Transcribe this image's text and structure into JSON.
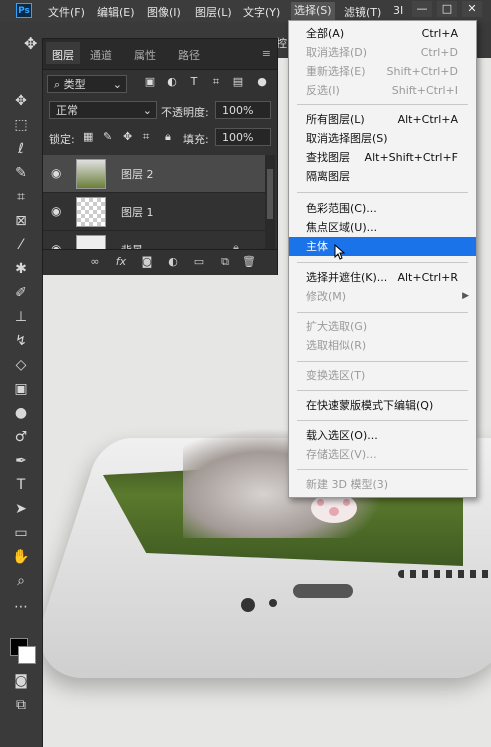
{
  "app": {
    "logo_text": "Ps"
  },
  "menubar": {
    "items": [
      {
        "label": "文件(F)"
      },
      {
        "label": "编辑(E)"
      },
      {
        "label": "图像(I)"
      },
      {
        "label": "图层(L)"
      },
      {
        "label": "文字(Y)"
      },
      {
        "label": "选择(S)"
      },
      {
        "label": "滤镜(T)"
      },
      {
        "label": "3I"
      }
    ],
    "window_buttons": [
      "—",
      "□",
      "✕"
    ]
  },
  "options_bar": {
    "move_icon": "move-icon",
    "label_partial": "控"
  },
  "layers_panel": {
    "tabs": [
      {
        "label": "图层"
      },
      {
        "label": "通道"
      },
      {
        "label": "属性"
      },
      {
        "label": "路径"
      }
    ],
    "filter_kind": "类型",
    "blend_mode": "正常",
    "opacity_label": "不透明度:",
    "opacity_value": "100%",
    "lock_label": "锁定:",
    "fill_label": "填充:",
    "fill_value": "100%",
    "layers": [
      {
        "name": "图层 2"
      },
      {
        "name": "图层 1"
      },
      {
        "name": "背景"
      }
    ]
  },
  "select_menu": {
    "items": [
      {
        "label": "全部(A)",
        "shortcut": "Ctrl+A",
        "enabled": true
      },
      {
        "label": "取消选择(D)",
        "shortcut": "Ctrl+D",
        "enabled": false
      },
      {
        "label": "重新选择(E)",
        "shortcut": "Shift+Ctrl+D",
        "enabled": false
      },
      {
        "label": "反选(I)",
        "shortcut": "Shift+Ctrl+I",
        "enabled": false
      },
      {
        "label": "所有图层(L)",
        "shortcut": "Alt+Ctrl+A",
        "enabled": true
      },
      {
        "label": "取消选择图层(S)",
        "shortcut": "",
        "enabled": true
      },
      {
        "label": "查找图层",
        "shortcut": "Alt+Shift+Ctrl+F",
        "enabled": true
      },
      {
        "label": "隔离图层",
        "shortcut": "",
        "enabled": true
      },
      {
        "label": "色彩范围(C)...",
        "shortcut": "",
        "enabled": true
      },
      {
        "label": "焦点区域(U)...",
        "shortcut": "",
        "enabled": true
      },
      {
        "label": "主体",
        "shortcut": "",
        "enabled": true,
        "highlighted": true
      },
      {
        "label": "选择并遮住(K)...",
        "shortcut": "Alt+Ctrl+R",
        "enabled": true
      },
      {
        "label": "修改(M)",
        "shortcut": "",
        "enabled": false,
        "submenu": true
      },
      {
        "label": "扩大选取(G)",
        "shortcut": "",
        "enabled": false
      },
      {
        "label": "选取相似(R)",
        "shortcut": "",
        "enabled": false
      },
      {
        "label": "变换选区(T)",
        "shortcut": "",
        "enabled": false
      },
      {
        "label": "在快速蒙版模式下编辑(Q)",
        "shortcut": "",
        "enabled": true
      },
      {
        "label": "载入选区(O)...",
        "shortcut": "",
        "enabled": true
      },
      {
        "label": "存储选区(V)...",
        "shortcut": "",
        "enabled": false
      },
      {
        "label": "新建 3D 模型(3)",
        "shortcut": "",
        "enabled": false
      }
    ]
  },
  "colors": {
    "highlight": "#1a73e8",
    "menu_bg": "#f3f3f3",
    "ui_dark": "#3a3a3a"
  }
}
